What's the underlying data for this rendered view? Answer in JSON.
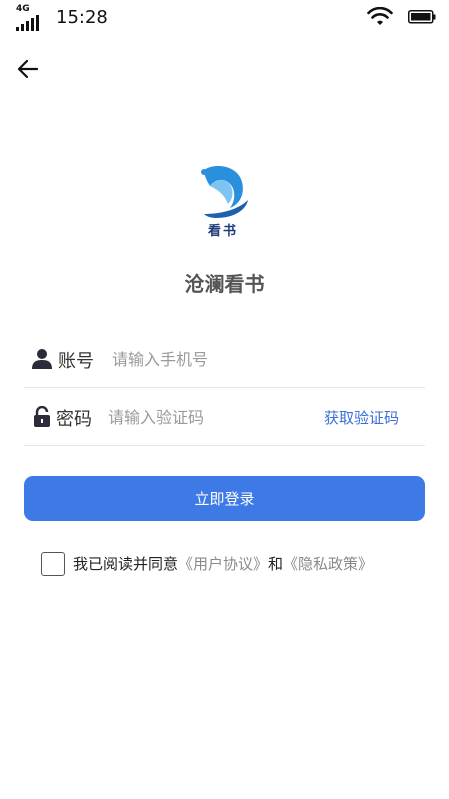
{
  "status_bar": {
    "network": "4G",
    "time": "15:28"
  },
  "app": {
    "logo_text": "看书",
    "name": "沧澜看书"
  },
  "form": {
    "account_label": "账号",
    "account_placeholder": "请输入手机号",
    "code_label": "密码",
    "code_placeholder": "请输入验证码",
    "get_code_label": "获取验证码"
  },
  "login_button": "立即登录",
  "agreement": {
    "prefix": "我已阅读并同意",
    "user_agreement": "《用户协议》",
    "conjunction": "和",
    "privacy_policy": "《隐私政策》"
  },
  "colors": {
    "primary": "#3d7ae6",
    "link": "#3a6fd8",
    "logo_blue": "#2a8fdc",
    "logo_dark": "#1e3b7a"
  },
  "icons": {
    "back": "arrow-left-icon",
    "account": "user-icon",
    "code": "lock-icon",
    "wifi": "wifi-icon",
    "battery": "battery-icon",
    "signal": "signal-icon"
  }
}
